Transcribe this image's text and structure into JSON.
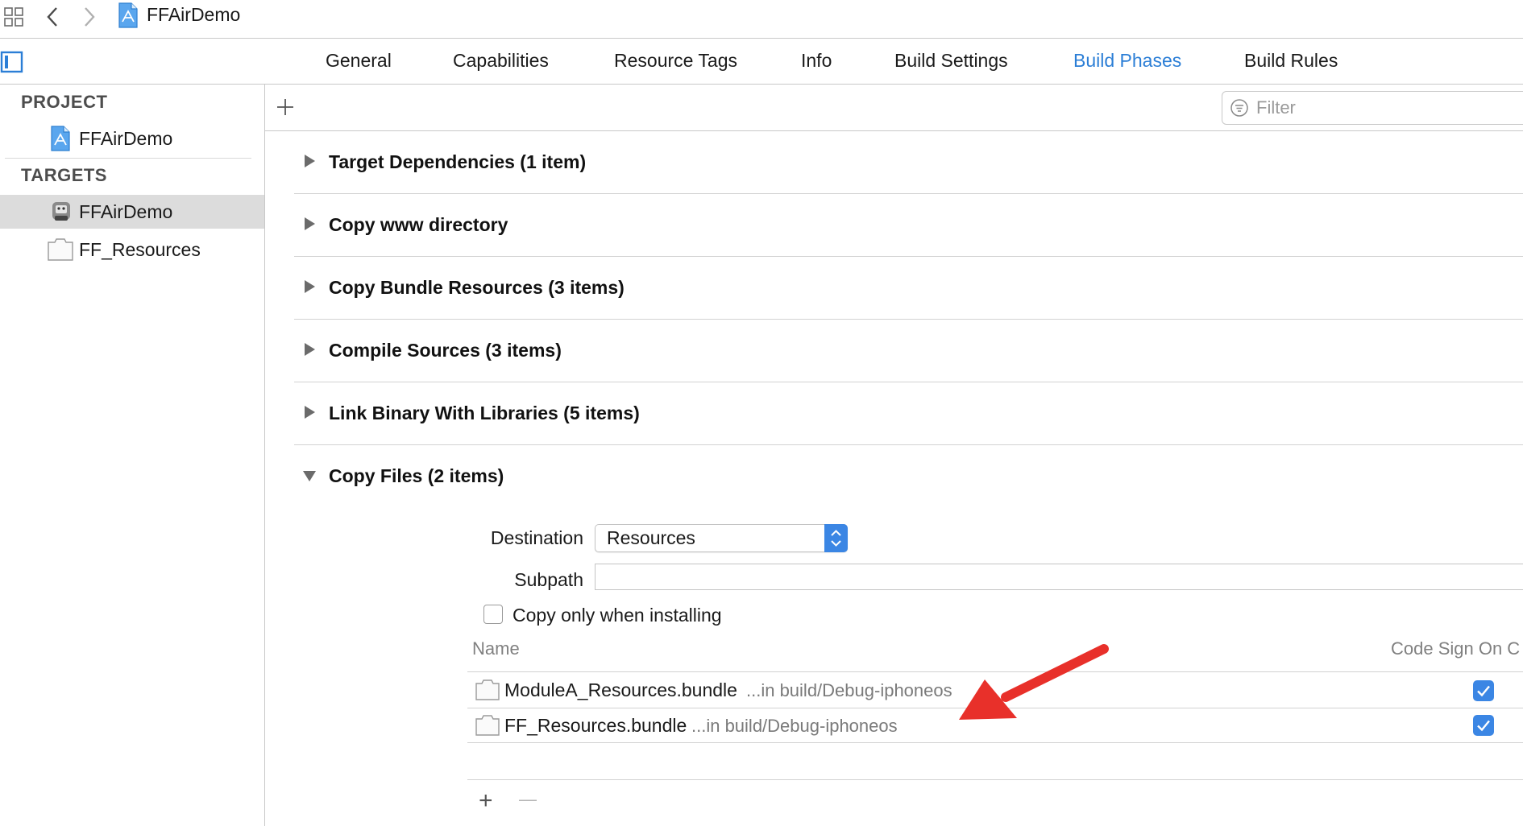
{
  "toolbar": {
    "project_title": "FFAirDemo"
  },
  "tabs": [
    {
      "label": "General"
    },
    {
      "label": "Capabilities"
    },
    {
      "label": "Resource Tags"
    },
    {
      "label": "Info"
    },
    {
      "label": "Build Settings"
    },
    {
      "label": "Build Phases",
      "active": true
    },
    {
      "label": "Build Rules"
    }
  ],
  "sidebar": {
    "project_header": "PROJECT",
    "project_item": "FFAirDemo",
    "targets_header": "TARGETS",
    "targets": [
      {
        "label": "FFAirDemo",
        "selected": true
      },
      {
        "label": "FF_Resources",
        "selected": false
      }
    ]
  },
  "filter": {
    "placeholder": "Filter"
  },
  "phases": [
    {
      "title": "Target Dependencies (1 item)",
      "expanded": false
    },
    {
      "title": "Copy www directory",
      "expanded": false
    },
    {
      "title": "Copy Bundle Resources (3 items)",
      "expanded": false
    },
    {
      "title": "Compile Sources (3 items)",
      "expanded": false
    },
    {
      "title": "Link Binary With Libraries (5 items)",
      "expanded": false
    },
    {
      "title": "Copy Files (2 items)",
      "expanded": true
    }
  ],
  "copy_files": {
    "destination_label": "Destination",
    "destination_value": "Resources",
    "subpath_label": "Subpath",
    "subpath_value": "",
    "copy_only_label": "Copy only when installing",
    "copy_only_checked": false,
    "columns": {
      "name": "Name",
      "code_sign": "Code Sign On C"
    },
    "files": [
      {
        "name": "ModuleA_Resources.bundle",
        "path": "...in build/Debug-iphoneos",
        "code_sign": true
      },
      {
        "name": "FF_Resources.bundle",
        "path": "...in build/Debug-iphoneos",
        "code_sign": true
      }
    ],
    "add_symbol": "+",
    "remove_symbol": "—"
  },
  "colors": {
    "accent": "#2b7ed6",
    "annotation_arrow": "#e8302a",
    "selection": "#dcdcdc"
  }
}
